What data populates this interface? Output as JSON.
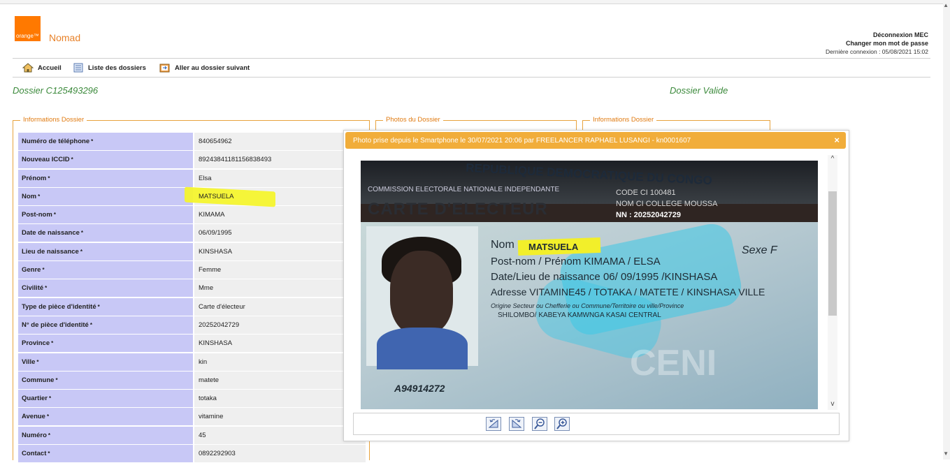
{
  "header": {
    "logo_text": "orange™",
    "app_name": "Nomad",
    "logout": "Déconnexion MEC",
    "change_password": "Changer mon mot de passe",
    "last_login": "Dernière connexion : 05/08/2021 15:02"
  },
  "nav": {
    "home": "Accueil",
    "list": "Liste des dossiers",
    "next": "Aller au dossier suivant"
  },
  "dossier": {
    "id": "Dossier C125493296",
    "status": "Dossier Valide"
  },
  "sections": {
    "info": "Informations Dossier",
    "photos": "Photos du Dossier",
    "info2": "Informations Dossier"
  },
  "rows": [
    {
      "label": "Numéro de téléphone",
      "value": "840654962"
    },
    {
      "label": "Nouveau ICCID",
      "value": "8924384118115683849​3"
    },
    {
      "label": "Prénom",
      "value": "Elsa"
    },
    {
      "label": "Nom",
      "value": "MATSUELA"
    },
    {
      "label": "Post-nom",
      "value": "KIMAMA"
    },
    {
      "label": "Date de naissance",
      "value": "06/09/1995"
    },
    {
      "label": "Lieu de naissance",
      "value": "KINSHASA"
    },
    {
      "label": "Genre",
      "value": "Femme"
    },
    {
      "label": "Civilité",
      "value": "Mme"
    },
    {
      "label": "Type de pièce d'identité",
      "value": "Carte d'électeur"
    },
    {
      "label": "N° de pièce d'identité",
      "value": "20252042729"
    },
    {
      "label": "Province",
      "value": "KINSHASA"
    },
    {
      "label": "Ville",
      "value": "kin"
    },
    {
      "label": "Commune",
      "value": "matete"
    },
    {
      "label": "Quartier",
      "value": "totaka"
    },
    {
      "label": "Avenue",
      "value": "vitamine"
    },
    {
      "label": "Numéro",
      "value": "45"
    },
    {
      "label": "Contact",
      "value": "0892292903"
    }
  ],
  "required_mark": "*",
  "modal": {
    "title": "Photo prise depuis le Smartphone le 30/07/2021 20:06 par FREELANCER RAPHAEL LUSANGI - kn0001607",
    "close": "×",
    "scroll_up": "^",
    "scroll_down": "v"
  },
  "photo_card": {
    "republic": "REPUBLIQUE DEMOCRATIQUE DU CONGO",
    "commission": "COMMISSION ELECTORALE NATIONALE INDEPENDANTE",
    "card_title": "CARTE D'ELECTEUR",
    "code": "CODE CI 100481",
    "school": "NOM CI COLLEGE MOUSSA",
    "nn": "NN : 20252042729",
    "nom_label": "Nom",
    "nom_value": "MATSUELA",
    "sexe": "Sexe F",
    "postnom": "Post-nom / Prénom  KIMAMA / ELSA",
    "date_lieu": "Date/Lieu de naissance  06/ 09/1995 /KINSHASA",
    "adresse": "Adresse  VITAMINE45 / TOTAKA / MATETE / KINSHASA VILLE",
    "origine": "Origine  Secteur ou Chefferie ou Commune/Territoire ou ville/Province",
    "origine_value": "SHILOMBO/ KABEYA KAMWNGA KASAI CENTRAL",
    "serial": "A94914272",
    "ceni": "CENI"
  },
  "colors": {
    "accent_orange": "#ff7900",
    "modal_header": "#f1ad3a",
    "label_bg": "#c8c8f6",
    "value_bg": "#efefef",
    "title_green": "#3c8a3c",
    "highlight": "#f4f42e"
  },
  "icons": [
    "home-icon",
    "folder-list-icon",
    "next-folder-icon",
    "rotate-left-icon",
    "rotate-right-icon",
    "zoom-out-icon",
    "zoom-in-icon"
  ]
}
